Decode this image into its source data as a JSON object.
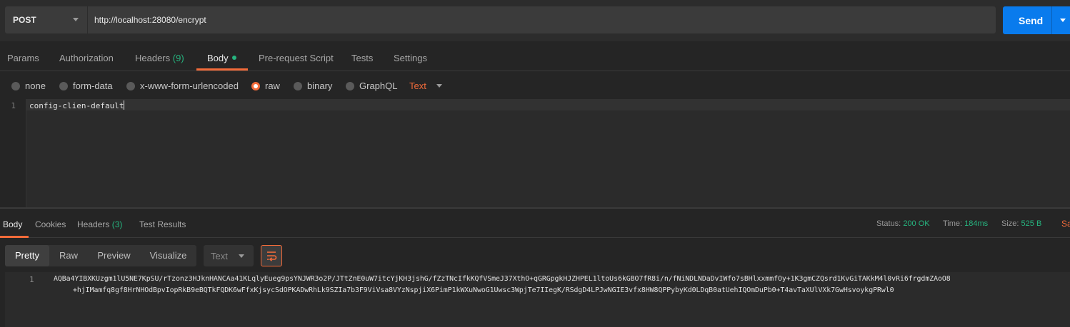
{
  "request": {
    "method": "POST",
    "url": "http://localhost:28080/encrypt",
    "send_label": "Send"
  },
  "request_tabs": [
    {
      "label": "Params"
    },
    {
      "label": "Authorization"
    },
    {
      "label": "Headers",
      "count": "(9)"
    },
    {
      "label": "Body",
      "active": true
    },
    {
      "label": "Pre-request Script"
    },
    {
      "label": "Tests"
    },
    {
      "label": "Settings"
    }
  ],
  "body_types": {
    "none": "none",
    "form_data": "form-data",
    "urlencoded": "x-www-form-urlencoded",
    "raw": "raw",
    "binary": "binary",
    "graphql": "GraphQL",
    "selected": "raw",
    "format": "Text"
  },
  "editor": {
    "line_number": "1",
    "content": "config-clien-default"
  },
  "response_tabs": {
    "body": "Body",
    "cookies": "Cookies",
    "headers": "Headers",
    "headers_count": "(3)",
    "test_results": "Test Results"
  },
  "response_meta": {
    "status_label": "Status:",
    "status_value": "200 OK",
    "time_label": "Time:",
    "time_value": "184ms",
    "size_label": "Size:",
    "size_value": "525 B",
    "save_label": "Sa"
  },
  "response_toolbar": {
    "pretty": "Pretty",
    "raw": "Raw",
    "preview": "Preview",
    "visualize": "Visualize",
    "format": "Text"
  },
  "response_body": {
    "line_number": "1",
    "line1": "AQBa4YIBXKUzgm1lU5NE7KpSU/rTzonz3HJknHANCAa41KLqlyEueg9psYNJWR3o2P/JTtZnE0uW7itcYjKH3jshG/fZzTNcIfkKQfVSmeJ37XthO+qGRGpgkHJZHPEL1ltoUs6kGBO7fR8i/n/fNiNDLNDaDvIWfo7sBHlxxmmfOy+1K3gmCZQsrd1KvGiTAKkM4l0vRi6frgdmZAoO8",
    "line2": "+hjIMamfq8gf8HrNHOdBpvIopRkB9eBQTkFQDK6wFfxKjsycSdOPKADwRhLk9SZIa7b3F9ViVsa8VYzNspjiX6PimP1kWXuNwoG1Uwsc3WpjTe7IIegK/RSdgD4LPJwNGIE3vfx8HW8QPPybyKd0LDqB0atUehIQOmDuPb0+T4avTaXUlVXk7GwHsvoykgPRwl0"
  },
  "colors": {
    "accent": "#f26b3a",
    "send": "#097bed",
    "success": "#26b47f"
  }
}
